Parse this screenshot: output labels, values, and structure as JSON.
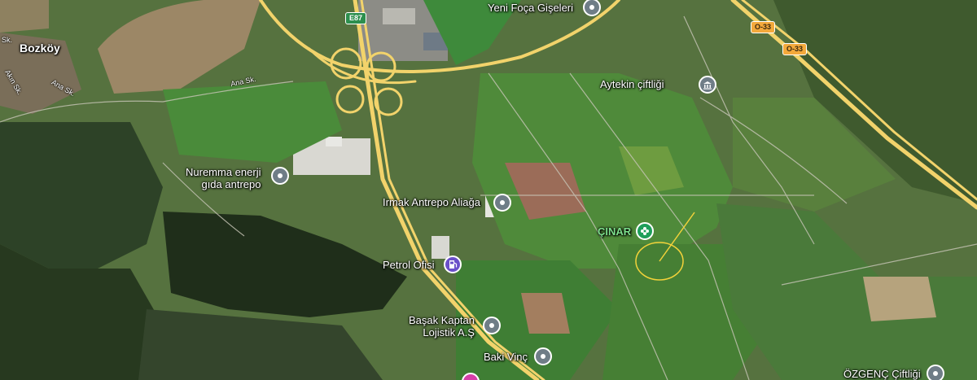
{
  "map": {
    "labels": {
      "bozkoy": "Bozköy",
      "ana_sk_1": "Ana Sk.",
      "ana_sk_2": "Ana Sk.",
      "sk_top": "Sk.",
      "akin_sk": "Akın Sk.",
      "yeni_foca": "Yeni Foça Gişeleri",
      "aytekin": "Aytekin çiftliği",
      "nuremma_line1": "Nuremma enerji",
      "nuremma_line2": "gıda antrepo",
      "irmak": "Irmak Antrepo Aliağa",
      "cinar": "ÇINAR",
      "petrol": "Petrol Ofisi",
      "basak_line1": "Başak Kaptan",
      "basak_line2": "Lojistik A.Ş",
      "baki": "Baki Vinç",
      "ozgenc": "ÖZGENÇ Çiftliği"
    },
    "shields": {
      "e87": "E87",
      "o33_a": "O-33",
      "o33_b": "O-33"
    },
    "pin_icons": {
      "yeni_foca": "place-pin-icon",
      "aytekin": "museum-icon",
      "nuremma": "place-pin-icon",
      "irmak": "place-pin-icon",
      "cinar": "flower-icon",
      "petrol": "gas-station-icon",
      "basak": "place-pin-icon",
      "baki": "place-pin-icon",
      "ozgenc": "place-pin-icon"
    },
    "colors": {
      "highway": "#f2d36b",
      "pin_gray": "#6f7d87",
      "pin_green": "#1e9e5a",
      "pin_purple": "#6a4fc9",
      "pin_pink": "#d63fa8",
      "annotation": "#f2d23a"
    }
  }
}
